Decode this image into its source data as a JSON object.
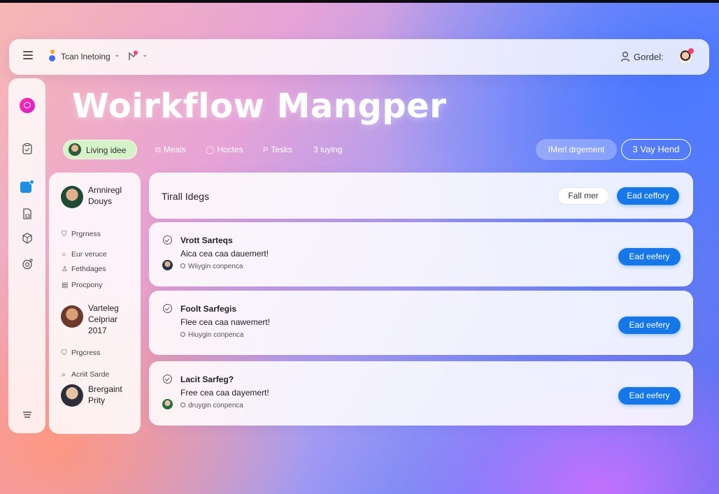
{
  "topbar": {
    "team_name": "Tcan lnetoing",
    "user_name": "Gordel:"
  },
  "title": "Woirkflow Mangper",
  "tabs": {
    "living": "Living idee",
    "meals": "Meals",
    "hoctes": "Hoctes",
    "tesks": "Tesks",
    "iuying": "3 iuying"
  },
  "actions": {
    "management": "IMerl drgement",
    "vay_hend": "3 Vay Hend"
  },
  "people_panel": {
    "person1": "Arnniregl\nDouys",
    "items1": [
      {
        "icon": "shield-icon",
        "label": "Prgrness"
      },
      {
        "icon": "circle-icon",
        "label": "Eur veruce"
      },
      {
        "icon": "person-icon",
        "label": "Fethdages"
      },
      {
        "icon": "card-icon",
        "label": "Procpony"
      }
    ],
    "person2": "Varteleg\nCelpriar\n2017",
    "items2": [
      {
        "icon": "shield-icon",
        "label": "Prgcress"
      },
      {
        "icon": "search-icon",
        "label": "Acriit Sarde"
      }
    ],
    "person3": "Brergaint\nPrity"
  },
  "header_card": {
    "title": "Tirall Idegs",
    "filter_label": "Fall mer",
    "primary_label": "Ead ceffory"
  },
  "tasks": [
    {
      "title": "Vrott Sarteqs",
      "subtitle": "Aica cea caa dauemert!",
      "meta": "Wiiygin conpenca",
      "button": "Ead eefery"
    },
    {
      "title": "Foolt Sarfegis",
      "subtitle": "Flee cea caa nawemert!",
      "meta": "Hiuygin conpenca",
      "button": "Ead eefery"
    },
    {
      "title": "Lacit Sarfeg?",
      "subtitle": "Free cea caa dayemert!",
      "meta": "druygin conpenca",
      "button": "Ead eefery"
    }
  ],
  "colors": {
    "accent_blue": "#1677e8",
    "chat_pink": "#e91ecb",
    "living_pill": "#d6f2c9"
  }
}
